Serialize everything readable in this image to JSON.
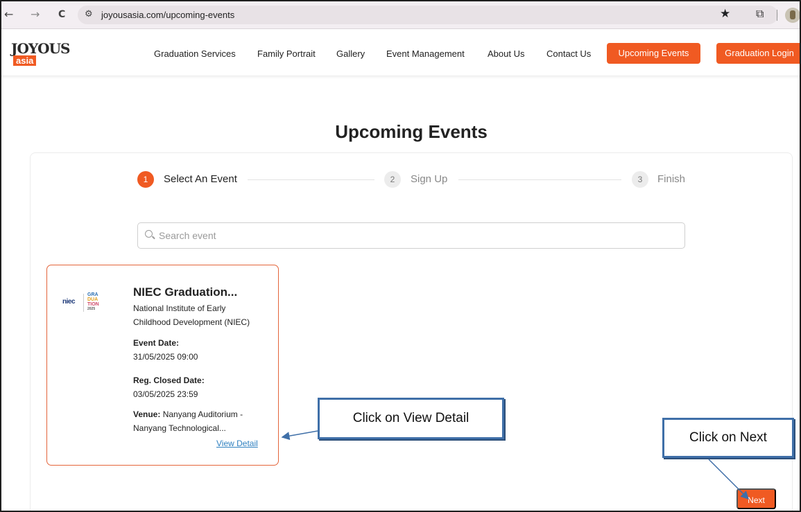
{
  "browser": {
    "url": "joyousasia.com/upcoming-events",
    "back_glyph": "←",
    "forward_glyph": "→",
    "reload_glyph": "C",
    "site_info_glyph": "⚙",
    "star_glyph": "★",
    "extension_glyph": "⧉"
  },
  "header": {
    "logo_text": "JOYOUS",
    "logo_sub": "asia",
    "nav": [
      "Graduation Services",
      "Family Portrait",
      "Gallery",
      "Event Management",
      "About Us",
      "Contact Us"
    ],
    "upcoming_events_button": "Upcoming Events",
    "graduation_login_button": "Graduation Login",
    "accent_color": "#f05a22"
  },
  "page": {
    "title": "Upcoming Events"
  },
  "steps": [
    {
      "number": "1",
      "label": "Select An Event",
      "active": true
    },
    {
      "number": "2",
      "label": "Sign Up",
      "active": false
    },
    {
      "number": "3",
      "label": "Finish",
      "active": false
    }
  ],
  "search": {
    "placeholder": "Search event"
  },
  "event": {
    "logo_left": "niec",
    "logo_right_lines": [
      "GRA",
      "DUA",
      "TION",
      "2025"
    ],
    "title": "NIEC Graduation...",
    "organizer_line1": "National Institute of Early",
    "organizer_line2": "Childhood Development (NIEC)",
    "event_date_label": "Event Date:",
    "event_date": "31/05/2025 09:00",
    "reg_closed_label": "Reg. Closed Date:",
    "reg_closed_date": "03/05/2025 23:59",
    "venue_label": "Venue:",
    "venue_line1": " Nanyang Auditorium -",
    "venue_line2": "Nanyang Technological...",
    "view_detail": "View Detail"
  },
  "next_button": "Next",
  "annotations": {
    "view_detail_callout": "Click on View Detail",
    "next_callout": "Click on Next"
  }
}
